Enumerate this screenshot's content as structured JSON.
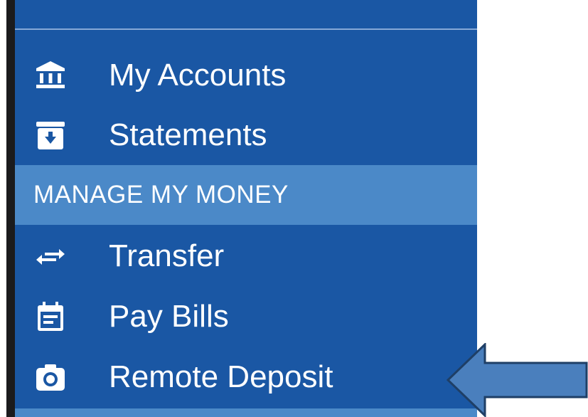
{
  "menu": {
    "items_top": [
      {
        "label": "My Accounts",
        "icon": "bank-icon"
      },
      {
        "label": "Statements",
        "icon": "statements-download-icon"
      }
    ],
    "section_header": "MANAGE MY MONEY",
    "items_money": [
      {
        "label": "Transfer",
        "icon": "transfer-icon"
      },
      {
        "label": "Pay Bills",
        "icon": "calendar-icon"
      },
      {
        "label": "Remote Deposit",
        "icon": "camera-icon"
      }
    ]
  },
  "colors": {
    "menu_bg": "#1a57a4",
    "section_bg": "#4b89c8",
    "text": "#ffffff",
    "arrow_fill": "#4a7fbd",
    "arrow_stroke": "#1f3f66"
  },
  "annotation": {
    "icon": "pointer-arrow-icon"
  }
}
